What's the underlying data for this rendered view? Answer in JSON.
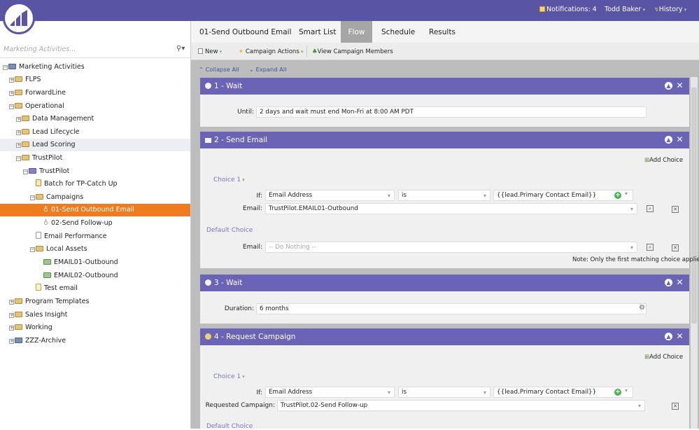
{
  "topbar": {
    "notifications": "Notifications: 4",
    "user": "Todd Baker",
    "history": "History"
  },
  "tabs": [
    "01-Send Outbound Email",
    "Smart List",
    "Flow",
    "Schedule",
    "Results"
  ],
  "toolbar": {
    "new": "New",
    "campaign_actions": "Campaign Actions",
    "view_members": "View Campaign Members"
  },
  "flow_controls": {
    "collapse": "Collapse All",
    "expand": "Expand All"
  },
  "search": {
    "placeholder": "Marketing Activities..."
  },
  "tree": [
    "Marketing Activities",
    "FLPS",
    "ForwardLine",
    "Operational",
    "Data Management",
    "Lead Lifecycle",
    "Lead Scoring",
    "TrustPilot",
    "TrustPilot",
    "Batch for TP-Catch Up",
    "Campaigns",
    "01-Send Outbound Email",
    "02-Send Follow-up",
    "Email Performance",
    "Local Assets",
    "EMAIL01-Outbound",
    "EMAIL02-Outbound",
    "Test email",
    "Program Templates",
    "Sales Insight",
    "Working",
    "ZZZ-Archive"
  ],
  "steps": {
    "s1": {
      "title": "1 - Wait",
      "until_label": "Until:",
      "until_value": "2 days and wait must end Mon-Fri at 8:00 AM PDT"
    },
    "s2": {
      "title": "2 - Send Email",
      "add_choice": "Add Choice",
      "choice": "Choice 1",
      "if_label": "If:",
      "if_field": "Email Address",
      "operator": "is",
      "value": "{{lead.Primary Contact Email}}",
      "email_label": "Email:",
      "email_value": "TrustPilot.EMAIL01-Outbound",
      "default_choice": "Default Choice",
      "default_email_label": "Email:",
      "default_email_value": "-- Do Nothing --",
      "note": "Note: Only the first matching choice applies"
    },
    "s3": {
      "title": "3 - Wait",
      "duration_label": "Duration:",
      "duration_value": "6 months"
    },
    "s4": {
      "title": "4 - Request Campaign",
      "add_choice": "Add Choice",
      "choice": "Choice 1",
      "if_label": "If:",
      "if_field": "Email Address",
      "operator": "is",
      "value": "{{lead.Primary Contact Email}}",
      "req_label": "Requested Campaign:",
      "req_value": "TrustPilot.02-Send Follow-up",
      "default_choice": "Default Choice"
    }
  }
}
